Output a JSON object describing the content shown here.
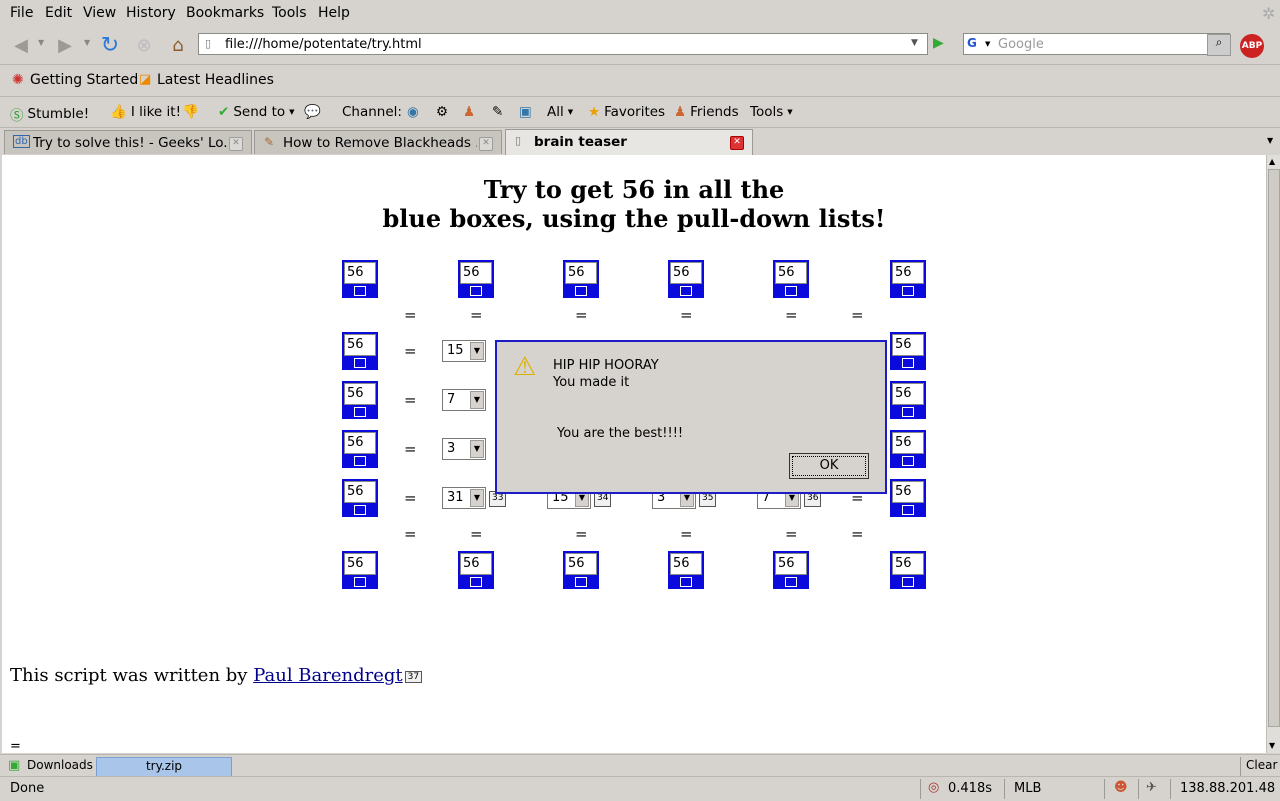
{
  "menu": [
    "File",
    "Edit",
    "View",
    "History",
    "Bookmarks",
    "Tools",
    "Help"
  ],
  "nav": {
    "url": "file:///home/potentate/try.html",
    "search_engine": "G",
    "search_placeholder": "Google",
    "adblock": "ABP"
  },
  "bookmarks": [
    "Getting Started",
    "Latest Headlines"
  ],
  "toolbar2": {
    "stumble": "Stumble!",
    "ilike": "I like it!",
    "sendto": "Send to",
    "channel": "Channel:",
    "all": "All",
    "favorites": "Favorites",
    "friends": "Friends",
    "tools": "Tools"
  },
  "tabs": [
    {
      "label": "Try to solve this! - Geeks' Lo...",
      "icon": "db-icon",
      "active": false
    },
    {
      "label": "How to Remove Blackheads ...",
      "icon": "pencil-icon",
      "active": false
    },
    {
      "label": "brain teaser",
      "icon": "page-icon",
      "active": true
    }
  ],
  "page": {
    "title_line1": "Try to get 56 in all the",
    "title_line2": "blue boxes, using the pull-down lists!",
    "box_value": "56",
    "equals": "=",
    "rows": [
      {
        "selects": [
          "15"
        ]
      },
      {
        "selects": [
          "7"
        ]
      },
      {
        "selects": [
          "3"
        ]
      },
      {
        "selects": [
          "31",
          "15",
          "3",
          "7"
        ],
        "tags": [
          "33",
          "34",
          "35",
          "36"
        ]
      }
    ],
    "footer_text": "This script was written by ",
    "footer_link": "Paul Barendregt",
    "footer_tag": "37"
  },
  "dialog": {
    "line1": "HIP HIP HOORAY",
    "line2": "You made it",
    "line3": "You are the best!!!!",
    "ok": "OK"
  },
  "downloads": {
    "label": "Downloads",
    "file": "try.zip",
    "clear": "Clear"
  },
  "status": {
    "text": "Done",
    "time": "0.418s",
    "mlb": "MLB",
    "ip": "138.88.201.48"
  }
}
